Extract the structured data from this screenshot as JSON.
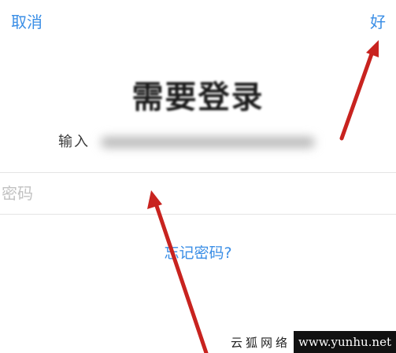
{
  "nav": {
    "cancel_label": "取消",
    "done_label": "好"
  },
  "login": {
    "title": "需要登录",
    "subtitle_prefix": "输入",
    "password_placeholder": "密码",
    "forgot_password_label": "忘记密码?"
  },
  "watermark": {
    "cn_text": "云狐网络",
    "url_text": "www.yunhu.net"
  },
  "colors": {
    "accent": "#3a8ee6",
    "annotation_arrow": "#c8231f"
  }
}
